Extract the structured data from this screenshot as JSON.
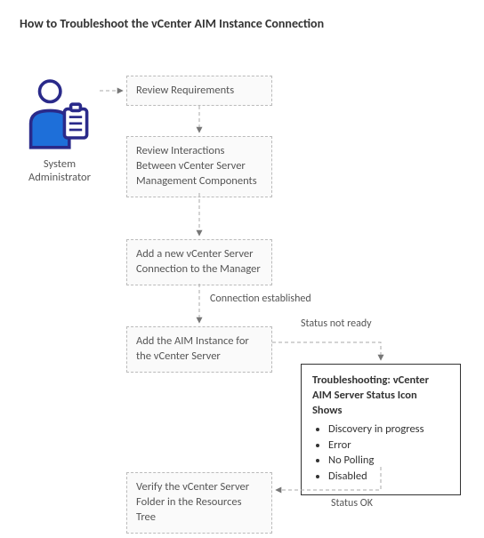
{
  "title": "How to Troubleshoot the vCenter AIM Instance Connection",
  "actor": {
    "label_line1": "System",
    "label_line2": "Administrator"
  },
  "steps": {
    "s1": "Review Requirements",
    "s2": "Review Interactions Between vCenter Server Management Components",
    "s3": "Add a new vCenter Server Connection to the Manager",
    "s4": "Add the AIM Instance for the vCenter Server",
    "s5": "Verify the vCenter Server Folder in the Resources Tree"
  },
  "edges": {
    "conn_established": "Connection established",
    "status_not_ready": "Status not ready",
    "status_ok": "Status OK"
  },
  "troubleshoot": {
    "title": "Troubleshooting: vCenter AIM Server Status Icon Shows",
    "items": [
      "Discovery in progress",
      "Error",
      "No Polling",
      "Disabled"
    ]
  }
}
